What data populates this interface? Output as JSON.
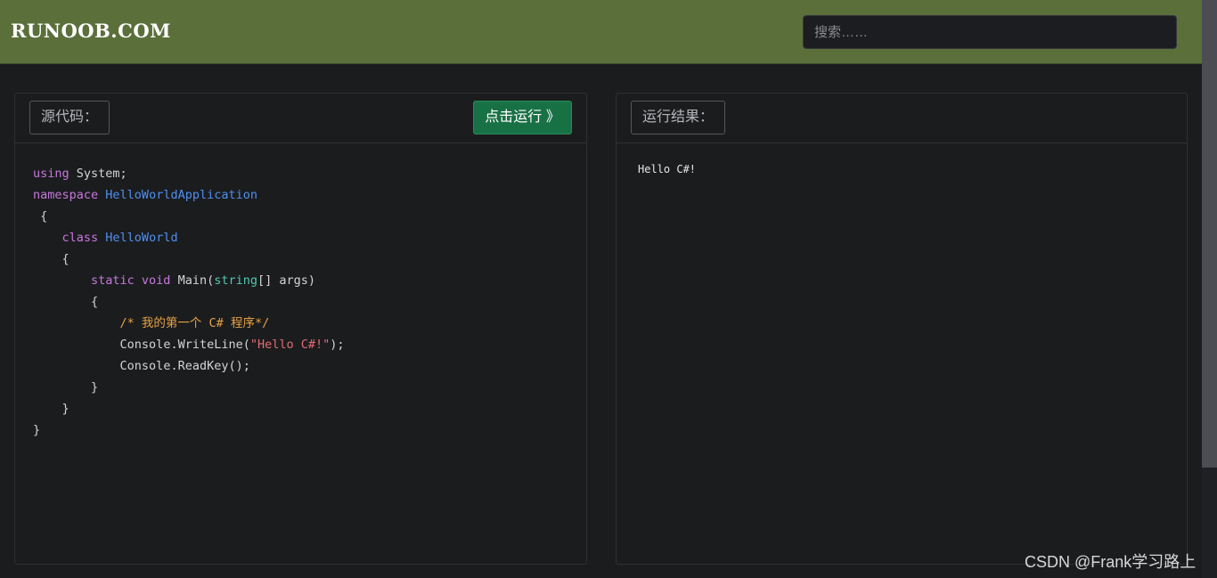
{
  "header": {
    "logo": "RUNOOB.COM",
    "search_placeholder": "搜索……"
  },
  "source_panel": {
    "label": "源代码：",
    "run_button": "点击运行 》",
    "code": {
      "l1_kw": "using",
      "l1_rest": " System;",
      "l2_kw": "namespace",
      "l2_name": "HelloWorldApplication",
      "l3": "{",
      "l4_kw": "class",
      "l4_name": "HelloWorld",
      "l5": "{",
      "l6_kw": "static void",
      "l6_rest1": " Main(",
      "l6_type": "string",
      "l6_rest2": "[] args)",
      "l7": "{",
      "l8_comment": "/* 我的第一个 C# 程序*/",
      "l9_pre": "Console.WriteLine(",
      "l9_str": "\"Hello C#!\"",
      "l9_post": ");",
      "l10": "Console.ReadKey();",
      "l11": "}",
      "l12": "}",
      "l13": "}"
    }
  },
  "result_panel": {
    "label": "运行结果：",
    "output": "Hello C#!"
  },
  "watermark": "CSDN @Frank学习路上"
}
